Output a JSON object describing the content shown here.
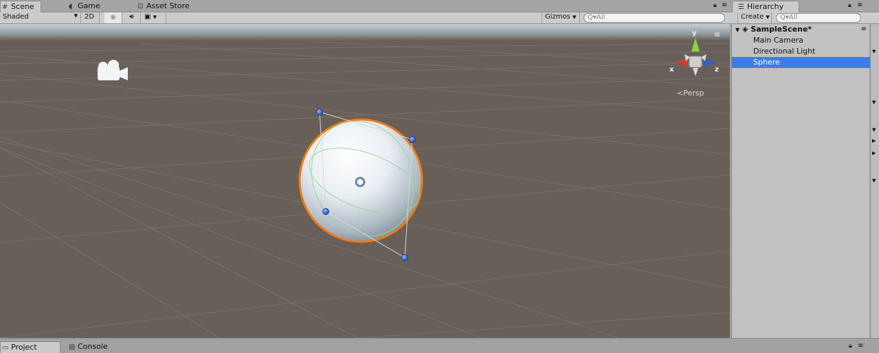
{
  "scene_tabs": [
    {
      "label": "Scene",
      "icon": "grid-icon",
      "active": true
    },
    {
      "label": "Game",
      "icon": "pacman-icon",
      "active": false
    },
    {
      "label": "Asset Store",
      "icon": "shopping-bag-icon",
      "active": false
    }
  ],
  "scene_toolbar": {
    "draw_mode": "Shaded",
    "mode_2d": "2D",
    "gizmos": "Gizmos",
    "search_placeholder": "Q▾All"
  },
  "viewport": {
    "persp_label": "Persp",
    "axis_x": "x",
    "axis_y": "y",
    "axis_z": "z",
    "colors": {
      "x": "#d23b2c",
      "y": "#8bd63c",
      "z": "#3360c8",
      "selection_outline": "#f07a14",
      "collider": "#8fdc8f",
      "handle": "#2d6de0"
    }
  },
  "hierarchy": {
    "tab_label": "Hierarchy",
    "create_label": "Create",
    "search_placeholder": "Q▾All",
    "scene_name": "SampleScene*",
    "items": [
      {
        "label": "Main Camera",
        "selected": false
      },
      {
        "label": "Directional Light",
        "selected": false
      },
      {
        "label": "Sphere",
        "selected": true
      }
    ]
  },
  "bottom_tabs": [
    {
      "label": "Project",
      "icon": "folder-icon",
      "active": true
    },
    {
      "label": "Console",
      "icon": "console-icon",
      "active": false
    }
  ]
}
